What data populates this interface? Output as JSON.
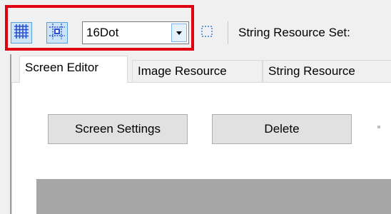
{
  "toolbar": {
    "grid_button": {
      "icon": "grid-icon",
      "pressed": true
    },
    "snap_button": {
      "icon": "snap-to-grid-icon",
      "pressed": true
    },
    "grid_size": {
      "selected": "16Dot",
      "arrow_icon": "chevron-down-icon"
    },
    "selection_button": {
      "icon": "dashed-selection-icon"
    },
    "string_resource_set_label": "String Resource Set:"
  },
  "tabs": [
    {
      "label": "Screen Editor",
      "active": true
    },
    {
      "label": "Image Resource",
      "active": false
    },
    {
      "label": "String Resource",
      "active": false
    }
  ],
  "screen_editor": {
    "screen_settings_label": "Screen Settings",
    "delete_label": "Delete"
  },
  "colors": {
    "highlight": "#e0000f",
    "pressed_button_bg": "#cce4f7",
    "pressed_button_border": "#5c9fd6",
    "canvas_area": "#a6a6a6"
  }
}
